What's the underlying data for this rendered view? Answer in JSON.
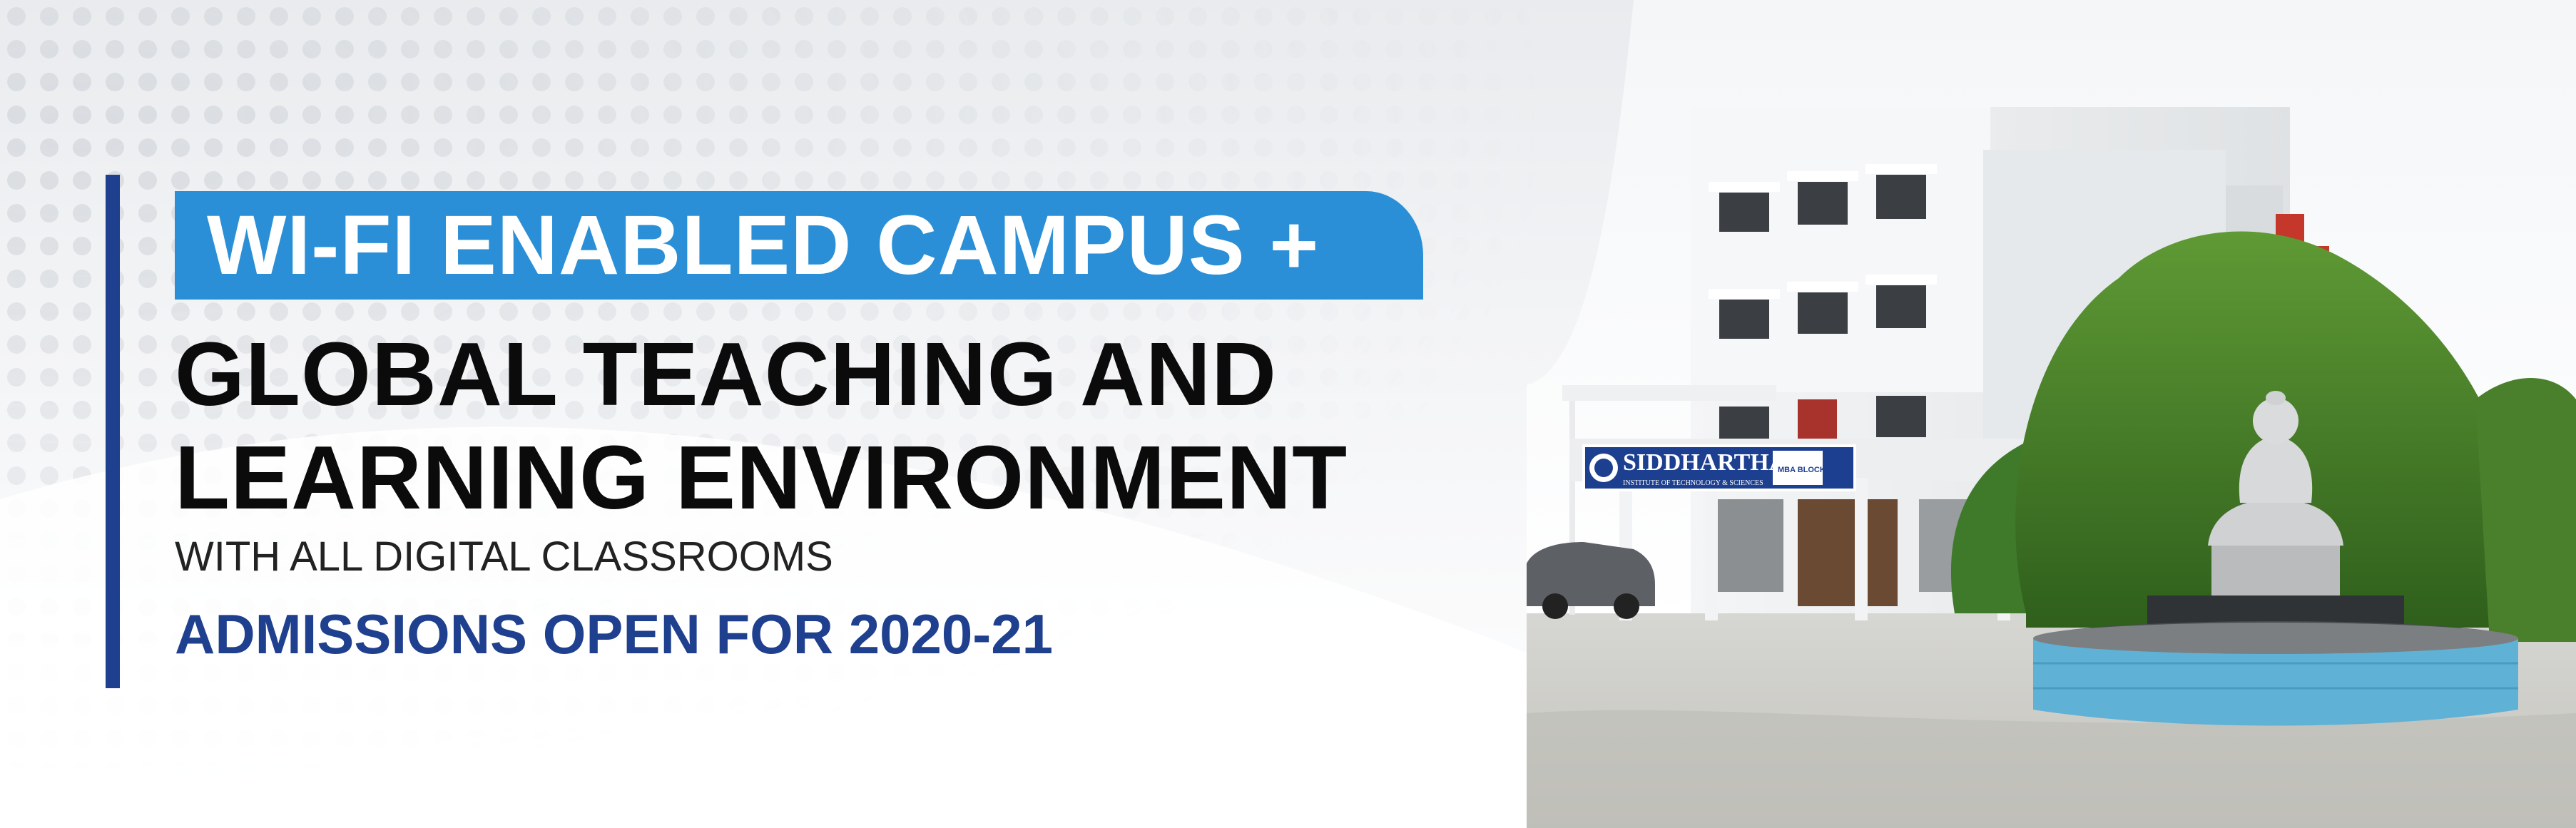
{
  "banner": {
    "headline_highlight": "WI-FI ENABLED CAMPUS +",
    "headline_line_2": "GLOBAL TEACHING AND",
    "headline_line_3": "LEARNING ENVIRONMENT",
    "subline": "WITH ALL DIGITAL CLASSROOMS",
    "admissions": "ADMISSIONS OPEN FOR 2020-21"
  },
  "photo": {
    "sign_name": "SIDDHARTHA",
    "sign_subtitle": "INSTITUTE OF TECHNOLOGY & SCIENCES",
    "sign_block": "MBA BLOCK"
  },
  "colors": {
    "highlight_blue": "#2a8fd6",
    "navy": "#1f3f8f",
    "headline_black": "#0b0b0b"
  }
}
